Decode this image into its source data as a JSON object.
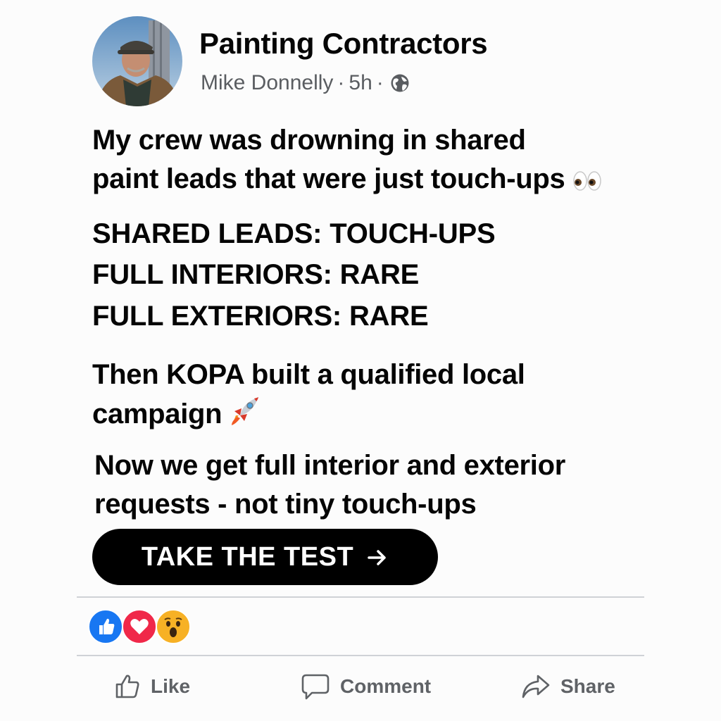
{
  "header": {
    "group_name": "Painting Contractors",
    "author": "Mike Donnelly",
    "separator": "·",
    "time": "5h",
    "privacy_icon": "globe-icon"
  },
  "post": {
    "line1": "My crew was drowning in shared",
    "line2": "paint leads that were just touch-ups",
    "line2_emoji": "eyes-emoji",
    "stats": [
      "SHARED LEADS: TOUCH-UPS",
      "FULL INTERIORS: RARE",
      "FULL EXTERIORS: RARE"
    ],
    "line3": "Then KOPA built a qualified local",
    "line4": "campaign",
    "line4_emoji": "rocket-emoji",
    "line5": "Now we get full interior and exterior",
    "line6": "requests - not tiny touch-ups"
  },
  "cta": {
    "label": "TAKE THE TEST",
    "icon": "arrow-right-icon"
  },
  "reactions": [
    "like-reaction",
    "love-reaction",
    "wow-reaction"
  ],
  "actions": {
    "like_label": "Like",
    "comment_label": "Comment",
    "share_label": "Share"
  },
  "colors": {
    "like_blue": "#1877f2",
    "love_red": "#f02849",
    "wow_yellow": "#f7b125",
    "cta_black": "#000000",
    "meta_gray": "#5a5d61"
  }
}
